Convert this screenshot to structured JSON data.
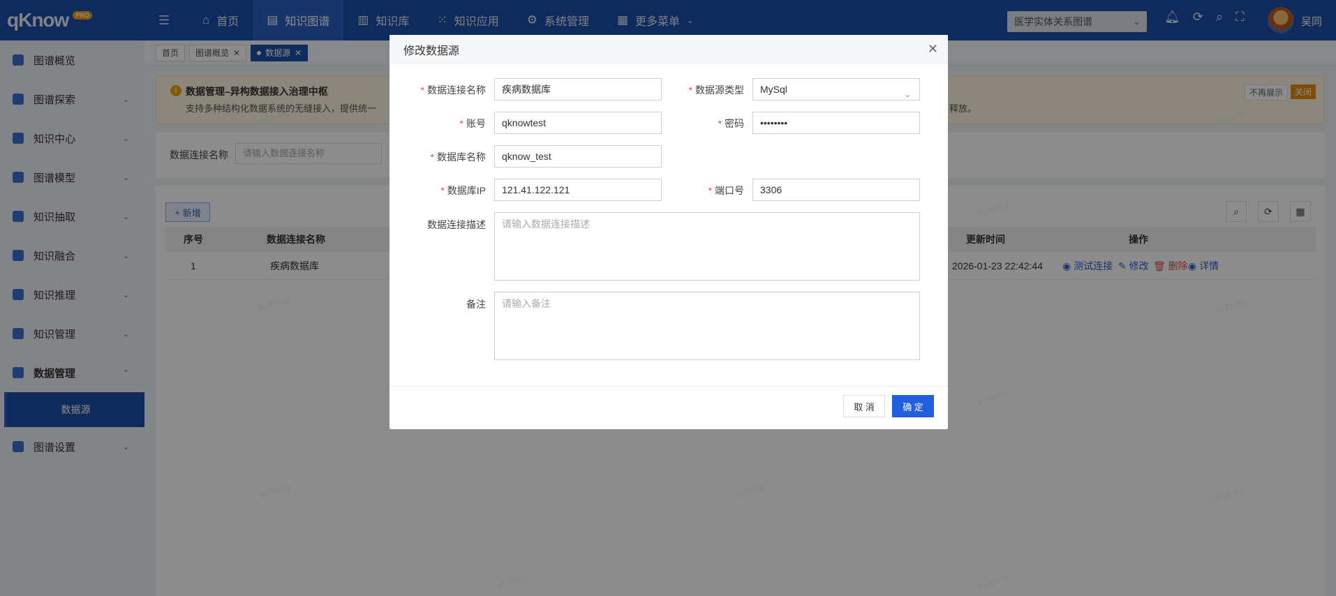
{
  "app": {
    "logo": "qKnow",
    "logo_badge": "PRO",
    "user": "吴同"
  },
  "topnav": [
    {
      "label": "首页",
      "icon": "home-icon"
    },
    {
      "label": "知识图谱",
      "icon": "book-icon",
      "active": true
    },
    {
      "label": "知识库",
      "icon": "library-icon"
    },
    {
      "label": "知识应用",
      "icon": "app-icon"
    },
    {
      "label": "系统管理",
      "icon": "gear-icon"
    },
    {
      "label": "更多菜单",
      "icon": "grid-icon"
    }
  ],
  "graph_select": {
    "value": "医学实体关系图谱"
  },
  "sidebar": {
    "items": [
      {
        "label": "图谱概览"
      },
      {
        "label": "图谱探索"
      },
      {
        "label": "知识中心"
      },
      {
        "label": "图谱模型"
      },
      {
        "label": "知识抽取"
      },
      {
        "label": "知识融合"
      },
      {
        "label": "知识推理"
      },
      {
        "label": "知识管理"
      },
      {
        "label": "数据管理"
      },
      {
        "label": "图谱设置"
      }
    ],
    "sub_active": "数据源"
  },
  "tabs": [
    {
      "label": "首页"
    },
    {
      "label": "图谱概览"
    },
    {
      "label": "数据源"
    }
  ],
  "notice": {
    "title": "数据管理–异构数据接入治理中枢",
    "text": "支持多种结构化数据系统的无缝接入，提供统一",
    "tail": "释放。",
    "dismiss": "不再展示",
    "close": "关闭"
  },
  "search": {
    "label": "数据连接名称",
    "placeholder": "请输入数据连接名称"
  },
  "table": {
    "add_label": "新增",
    "headers": {
      "index": "序号",
      "name": "数据连接名称",
      "updated": "更新时间",
      "ops": "操作"
    },
    "rows": [
      {
        "index": "1",
        "name": "疾病数据库",
        "updated": "2026-01-23 22:42:44"
      }
    ],
    "ops": {
      "test": "测试连接",
      "edit": "修改",
      "delete": "删除",
      "detail": "详情"
    }
  },
  "watermark": "wutong",
  "modal": {
    "title": "修改数据源",
    "fields": {
      "conn_name": {
        "label": "数据连接名称",
        "value": "疾病数据库"
      },
      "db_type": {
        "label": "数据源类型",
        "value": "MySql"
      },
      "account": {
        "label": "账号",
        "value": "qknowtest"
      },
      "password": {
        "label": "密码",
        "value": "••••••••"
      },
      "db_name": {
        "label": "数据库名称",
        "value": "qknow_test"
      },
      "db_ip": {
        "label": "数据库IP",
        "value": "121.41.122.121"
      },
      "port": {
        "label": "端口号",
        "value": "3306"
      },
      "desc": {
        "label": "数据连接描述",
        "placeholder": "请输入数据连接描述"
      },
      "remark": {
        "label": "备注",
        "placeholder": "请输入备注"
      }
    },
    "cancel": "取 消",
    "ok": "确 定"
  }
}
